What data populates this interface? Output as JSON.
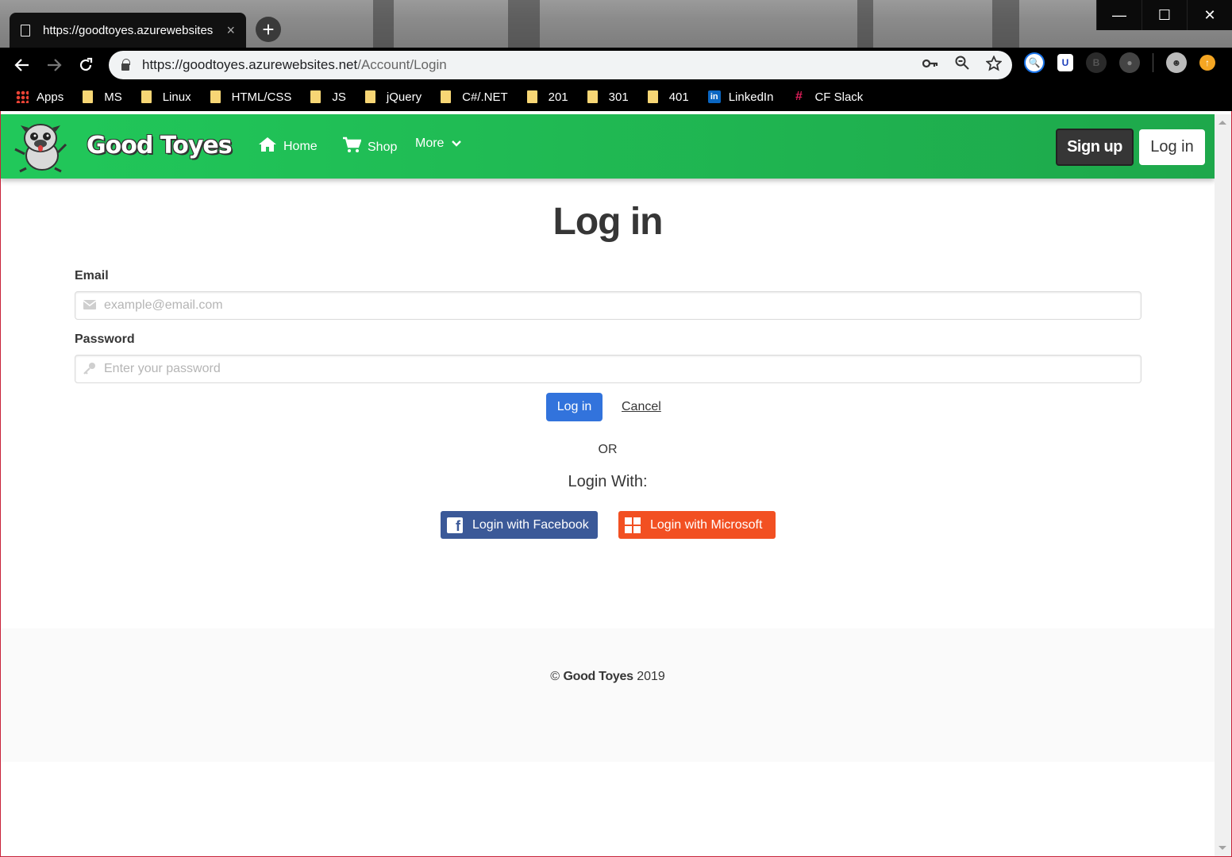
{
  "browser": {
    "tab_title": "https://goodtoyes.azurewebsites",
    "tab_close": "×",
    "new_tab": "+",
    "url_host": "https://goodtoyes.azurewebsites.net",
    "url_path": "/Account/Login",
    "window_controls": {
      "minimize": "—",
      "maximize": "☐",
      "close": "✕"
    },
    "bookmarks": [
      {
        "label": "Apps",
        "icon": "apps-grid-icon"
      },
      {
        "label": "MS",
        "icon": "folder-icon"
      },
      {
        "label": "Linux",
        "icon": "folder-icon"
      },
      {
        "label": "HTML/CSS",
        "icon": "folder-icon"
      },
      {
        "label": "JS",
        "icon": "folder-icon"
      },
      {
        "label": "jQuery",
        "icon": "folder-icon"
      },
      {
        "label": "C#/.NET",
        "icon": "folder-icon"
      },
      {
        "label": "201",
        "icon": "folder-icon"
      },
      {
        "label": "301",
        "icon": "folder-icon"
      },
      {
        "label": "401",
        "icon": "folder-icon"
      },
      {
        "label": "LinkedIn",
        "icon": "linkedin-icon"
      },
      {
        "label": "CF Slack",
        "icon": "slack-icon"
      }
    ]
  },
  "site": {
    "brand": "Good Toyes",
    "nav": {
      "home": "Home",
      "shop": "Shop",
      "more": "More"
    },
    "signup_label": "Sign up",
    "login_label": "Log in"
  },
  "login": {
    "title": "Log in",
    "email_label": "Email",
    "email_placeholder": "example@email.com",
    "password_label": "Password",
    "password_placeholder": "Enter your password",
    "submit_label": "Log in",
    "cancel_label": "Cancel",
    "or_text": "OR",
    "login_with": "Login With:",
    "facebook_label": "Login with Facebook",
    "microsoft_label": "Login with Microsoft"
  },
  "footer": {
    "copyright_symbol": "©",
    "company": "Good Toyes",
    "year": "2019"
  },
  "colors": {
    "nav_green": "#21c85a",
    "primary_blue": "#3273dc",
    "facebook_blue": "#3b5998",
    "microsoft_orange": "#f25022"
  }
}
